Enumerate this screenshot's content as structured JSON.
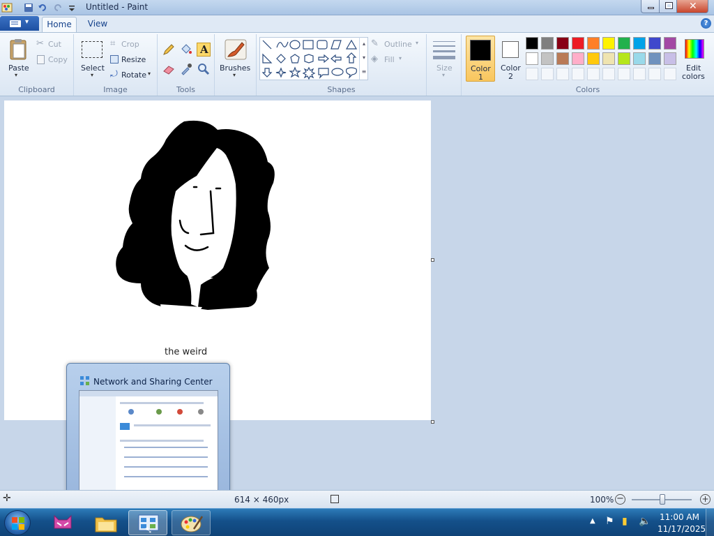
{
  "window": {
    "title": "Untitled - Paint"
  },
  "tabs": [
    {
      "label": "Home"
    },
    {
      "label": "View"
    }
  ],
  "clipboard": {
    "paste": "Paste",
    "cut": "Cut",
    "copy": "Copy",
    "group": "Clipboard"
  },
  "image": {
    "select": "Select",
    "crop": "Crop",
    "resize": "Resize",
    "rotate": "Rotate",
    "group": "Image"
  },
  "tools": {
    "group": "Tools"
  },
  "brushes": {
    "label": "Brushes"
  },
  "shapes": {
    "outline": "Outline",
    "fill": "Fill",
    "group": "Shapes"
  },
  "size": {
    "label": "Size"
  },
  "colors": {
    "color1_a": "Color",
    "color1_b": "1",
    "color2_a": "Color",
    "color2_b": "2",
    "edit_a": "Edit",
    "edit_b": "colors",
    "group": "Colors",
    "selected_color1": "#000000",
    "selected_color2": "#ffffff",
    "palette_row1": [
      "#000000",
      "#7f7f7f",
      "#880015",
      "#ed1c24",
      "#ff7f27",
      "#fff200",
      "#22b14c",
      "#00a2e8",
      "#3f48cc",
      "#a349a4"
    ],
    "palette_row2": [
      "#ffffff",
      "#c3c3c3",
      "#b97a57",
      "#ffaec9",
      "#ffc90e",
      "#efe4b0",
      "#b5e61d",
      "#99d9ea",
      "#7092be",
      "#c8bfe7"
    ]
  },
  "canvas": {
    "caption": "the weird"
  },
  "thumbnail": {
    "title": "Network and Sharing Center"
  },
  "status": {
    "canvas_size": "614 × 460px",
    "zoom": "100%"
  },
  "clock": {
    "time": "11:00 AM",
    "date": "11/17/2025"
  }
}
